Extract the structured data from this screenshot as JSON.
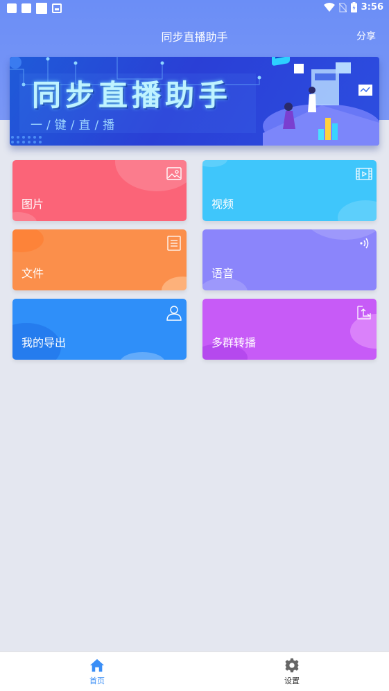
{
  "status_bar": {
    "time": "3:56"
  },
  "header": {
    "title": "同步直播助手",
    "share_label": "分享"
  },
  "banner": {
    "title": "同步直播助手",
    "subtitle": "一/键/直/播"
  },
  "cards": [
    {
      "label": "图片",
      "icon": "image-icon",
      "color": "#fb6478"
    },
    {
      "label": "视频",
      "icon": "video-icon",
      "color": "#3fc6fb"
    },
    {
      "label": "文件",
      "icon": "document-icon",
      "color": "#fb8f4b"
    },
    {
      "label": "语音",
      "icon": "voice-icon",
      "color": "#8b85fb"
    },
    {
      "label": "我的导出",
      "icon": "user-icon",
      "color": "#2f8ff9"
    },
    {
      "label": "多群转播",
      "icon": "forward-icon",
      "color": "#c75bf7"
    }
  ],
  "bottom_nav": {
    "items": [
      {
        "label": "首页",
        "icon": "home-icon",
        "active": true
      },
      {
        "label": "设置",
        "icon": "gear-icon",
        "active": false
      }
    ],
    "active_color": "#3a8ef6"
  }
}
